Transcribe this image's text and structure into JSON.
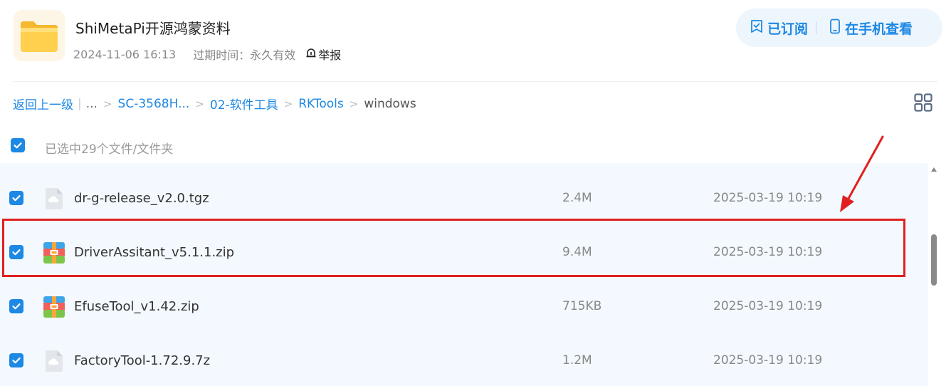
{
  "header": {
    "title": "ShiMetaPi开源鸿蒙资料",
    "date": "2024-11-06 16:13",
    "expire_label": "过期时间：永久有效",
    "report_label": "举报",
    "subscribe_label": "已订阅",
    "view_on_phone_label": "在手机查看"
  },
  "breadcrumb": {
    "back_label": "返回上一级",
    "ellipsis": "...",
    "items": [
      "SC-3568H...",
      "02-软件工具",
      "RKTools"
    ],
    "current": "windows",
    "separator": ">"
  },
  "selection": {
    "label": "已选中29个文件/文件夹",
    "all_checked": true
  },
  "files": [
    {
      "name": "dr-g-release_v2.0.tgz",
      "size": "2.4M",
      "date": "2025-03-19 10:19",
      "icon": "cloud-file-icon",
      "checked": true
    },
    {
      "name": "DriverAssitant_v5.1.1.zip",
      "size": "9.4M",
      "date": "2025-03-19 10:19",
      "icon": "zip-file-icon",
      "checked": true
    },
    {
      "name": "EfuseTool_v1.42.zip",
      "size": "715KB",
      "date": "2025-03-19 10:19",
      "icon": "zip-file-icon",
      "checked": true
    },
    {
      "name": "FactoryTool-1.72.9.7z",
      "size": "1.2M",
      "date": "2025-03-19 10:19",
      "icon": "cloud-file-icon",
      "checked": true
    }
  ],
  "colors": {
    "accent": "#1e88e5",
    "highlight": "#e02020",
    "list_bg": "#f3f9fe"
  }
}
